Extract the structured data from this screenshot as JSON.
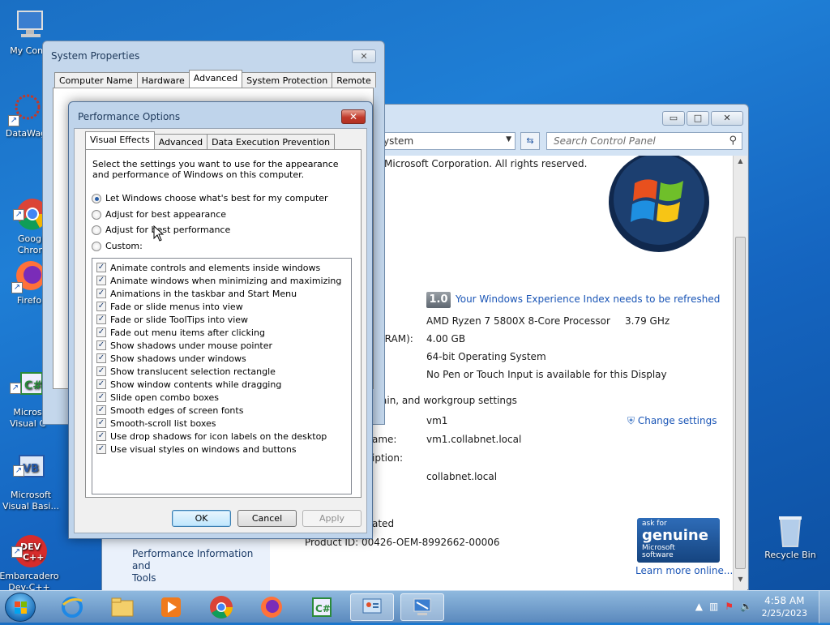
{
  "desktop": {
    "icons": [
      {
        "label": "My Comp"
      },
      {
        "label": "DataWag"
      },
      {
        "label": "Googl\nChron"
      },
      {
        "label": "Firefo"
      },
      {
        "label": "Micros\nVisual C"
      },
      {
        "label": "Microsoft\nVisual Basi..."
      },
      {
        "label": "Embarcadero\nDev-C++"
      },
      {
        "label": "Recycle Bin"
      }
    ]
  },
  "control_panel": {
    "address": "ystem",
    "search_placeholder": "Search Control Panel",
    "copyright": "Microsoft Corporation.  All rights reserved.",
    "wei_score": "1.0",
    "wei_link": "Your Windows Experience Index needs to be refreshed",
    "processor": "AMD Ryzen 7 5800X 8-Core Processor",
    "processor_speed": "3.79 GHz",
    "ram_label": "(RAM):",
    "ram": "4.00 GB",
    "system_type": "64-bit Operating System",
    "pen_touch": "No Pen or Touch Input is available for this Display",
    "domain_heading": "ain, and workgroup settings",
    "computer_name": "vm1",
    "change_settings": "Change settings",
    "full_name_label": "ame:",
    "full_name": "vm1.collabnet.local",
    "description_label": "iption:",
    "domain": "collabnet.local",
    "activated": "ated",
    "product_id": "Product ID: 00426-OEM-8992662-00006",
    "left_link": "Performance Information and\nTools",
    "genuine_line1": "ask for",
    "genuine_line2": "genuine",
    "genuine_line3": "Microsoft",
    "genuine_line4": "software",
    "learn_more": "Learn more online..."
  },
  "system_properties": {
    "title": "System Properties",
    "tabs": [
      "Computer Name",
      "Hardware",
      "Advanced",
      "System Protection",
      "Remote"
    ],
    "active_tab": "Advanced"
  },
  "performance_options": {
    "title": "Performance Options",
    "tabs": [
      "Visual Effects",
      "Advanced",
      "Data Execution Prevention"
    ],
    "description": "Select the settings you want to use for the appearance and performance of Windows on this computer.",
    "radios": [
      {
        "label": "Let Windows choose what's best for my computer",
        "selected": true
      },
      {
        "label": "Adjust for best appearance",
        "selected": false
      },
      {
        "label": "Adjust for best performance",
        "selected": false
      },
      {
        "label": "Custom:",
        "selected": false
      }
    ],
    "effects": [
      "Animate controls and elements inside windows",
      "Animate windows when minimizing and maximizing",
      "Animations in the taskbar and Start Menu",
      "Fade or slide menus into view",
      "Fade or slide ToolTips into view",
      "Fade out menu items after clicking",
      "Show shadows under mouse pointer",
      "Show shadows under windows",
      "Show translucent selection rectangle",
      "Show window contents while dragging",
      "Slide open combo boxes",
      "Smooth edges of screen fonts",
      "Smooth-scroll list boxes",
      "Use drop shadows for icon labels on the desktop",
      "Use visual styles on windows and buttons"
    ],
    "ok": "OK",
    "cancel": "Cancel",
    "apply": "Apply"
  },
  "taskbar": {
    "time": "4:58 AM",
    "date": "2/25/2023"
  }
}
